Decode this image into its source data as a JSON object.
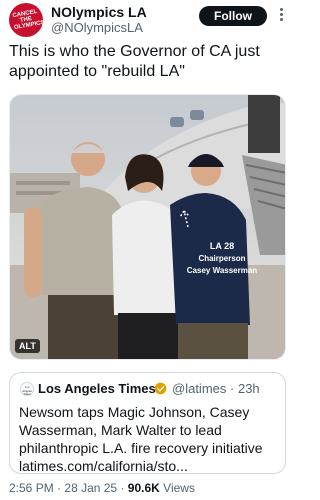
{
  "tweet": {
    "author_name": "NOlympics LA",
    "author_handle": "@NOlympicsLA",
    "avatar_text": "CANCEL THE OLYMPICS",
    "follow_label": "Follow",
    "text": "This is who the Governor of CA just appointed to \"rebuild LA\"",
    "media": {
      "alt_label": "ALT",
      "overlay_text": [
        "LA 28",
        "Chairperson",
        "Casey Wasserman"
      ]
    },
    "quoted": {
      "logo_text": "Los Angeles Times",
      "source_name": "Los Angeles Times",
      "source_handle": "@latimes",
      "age": "23h",
      "text": "Newsom taps Magic Johnson, Casey Wasserman, Mark Walter to lead philanthropic L.A. fire recovery initiative latimes.com/california/sto..."
    },
    "meta": {
      "time": "2:56 PM",
      "date": "28 Jan 25",
      "views_count": "90.6K",
      "views_label": "Views"
    }
  },
  "colors": {
    "avatar": "#c8102e",
    "follow_button": "#0f1419",
    "verified_badge": "#e2a000",
    "overlay_text": "#ffffff"
  }
}
